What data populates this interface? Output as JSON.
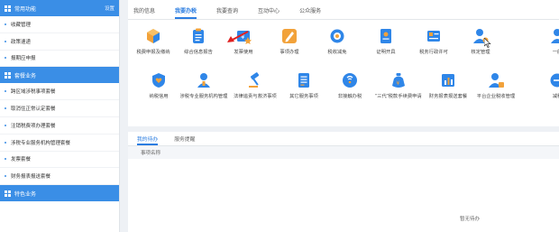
{
  "sidebar": {
    "section1": {
      "title": "常用功能",
      "setting": "设置"
    },
    "items1": [
      "收藏管理",
      "政策速递",
      "报期应申报"
    ],
    "section2": {
      "title": "套餐业务"
    },
    "items2": [
      "跨区域涉税事项套餐",
      "取消住正常认定套餐",
      "注销税费项办理套餐",
      "涉税专业服务机构管理套餐",
      "发票套餐",
      "财务报表报送套餐"
    ],
    "section3": {
      "title": "特色业务"
    }
  },
  "tabs": [
    "我的信息",
    "我要办税",
    "我要查询",
    "互动中心",
    "公众服务"
  ],
  "active_tab_index": 1,
  "services": [
    {
      "label": "税费申报及缴纳",
      "icon": "cube-icon"
    },
    {
      "label": "综合信息报告",
      "icon": "clipboard-icon"
    },
    {
      "label": "发票使用",
      "icon": "invoice-icon"
    },
    {
      "label": "事项办理",
      "icon": "pencil-icon"
    },
    {
      "label": "税收减免",
      "icon": "tax-relief-icon"
    },
    {
      "label": "证明开具",
      "icon": "certificate-icon"
    },
    {
      "label": "税务行政许可",
      "icon": "license-icon"
    },
    {
      "label": "核定管理",
      "icon": "user-check-icon"
    },
    {
      "label": "一般",
      "icon": "user-icon"
    },
    {
      "label": "纳税信用",
      "icon": "heart-shield-icon"
    },
    {
      "label": "涉税专业服务机构管理",
      "icon": "agency-icon"
    },
    {
      "label": "法律追责与救济事项",
      "icon": "gavel-icon"
    },
    {
      "label": "其它服务事项",
      "icon": "document-list-icon"
    },
    {
      "label": "非接触办税",
      "icon": "contactless-icon"
    },
    {
      "label": "\"三代\"税款手续费申请",
      "icon": "money-bag-icon"
    },
    {
      "label": "财务报表报送套餐",
      "icon": "report-icon"
    },
    {
      "label": "平台企业税收管理",
      "icon": "platform-user-icon"
    },
    {
      "label": "减税",
      "icon": "reduce-tax-icon"
    }
  ],
  "bottom": {
    "tabs": [
      "我的待办",
      "服务提醒"
    ],
    "column": "事项名称",
    "empty": "暂无待办"
  },
  "colors": {
    "primary": "#3a8ee6",
    "icon_blue": "#2f86e8",
    "icon_orange": "#f2a23a"
  }
}
